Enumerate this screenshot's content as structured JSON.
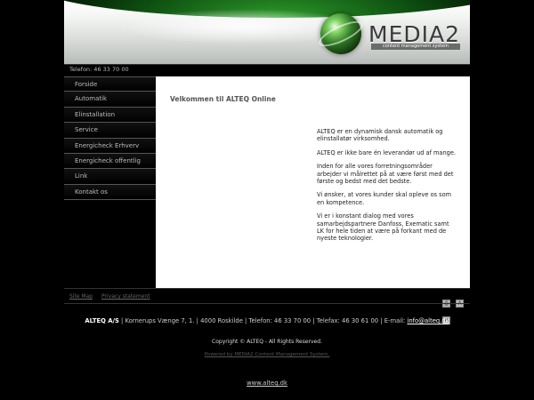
{
  "header": {
    "logo_text": "MEDIA2",
    "logo_subtitle": "content management system"
  },
  "phone": "Telefon: 46 33 70 00",
  "nav": [
    {
      "label": "Forside"
    },
    {
      "label": "Automatik"
    },
    {
      "label": "Elinstallation"
    },
    {
      "label": "Service"
    },
    {
      "label": "Energicheck Erhverv"
    },
    {
      "label": "Energicheck offentlig"
    },
    {
      "label": "Link"
    },
    {
      "label": "Kontakt os"
    }
  ],
  "content": {
    "welcome": "Velkommen til ALTEQ Online",
    "paragraphs": [
      "ALTEQ er en dynamisk dansk automatik og elinstallatør virksomhed.",
      "ALTEQ er ikke bare én leverandør ud af mange.",
      "Inden for alle vores forretningsområder arbejder vi målrettet på at være først med det første og bedst med det bedste.",
      "Vi ønsker, at vores kunder skal opleve os som en kompetence.",
      "Vi er i konstant dialog med vores samarbejdspartnere Danfoss, Exematic samt LK for hele tiden at være på forkant med de nyeste teknologier."
    ]
  },
  "footer": {
    "links": [
      "Site Map",
      "Privacy statement"
    ],
    "tools": [
      {
        "icon": "print-icon",
        "glyph": "⎙"
      },
      {
        "icon": "font-size-icon",
        "glyph": "A"
      },
      {
        "icon": "font-size-large-icon",
        "glyph": "A"
      }
    ],
    "company": "ALTEQ A/S",
    "address": " | Kornerups Vænge 7, 1. | 4000 Roskilde | Telefon: 46 33 70 00 | Telefax: 46 30 61 00 | E-mail: ",
    "email": "info@alteq.dk",
    "copyright": "Copyright © ALTEQ - All Rights Reserved.",
    "powered": "Powered by MEDIA2 Content Management System.",
    "site_url": "www.alteq.dk"
  },
  "colors": {
    "background": "#000000",
    "content_bg": "#ffffff",
    "accent_green": "#2f7a25"
  }
}
